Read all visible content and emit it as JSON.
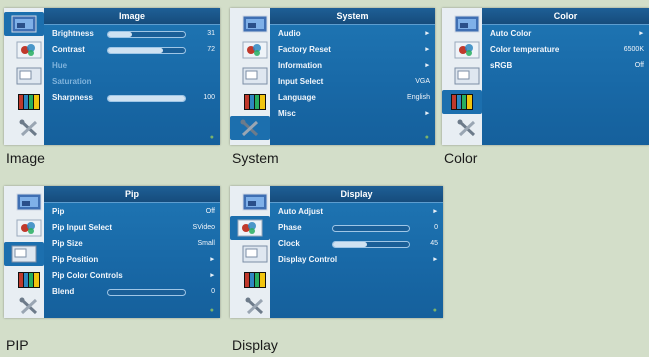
{
  "screens": [
    {
      "title": "Image",
      "caption": "Image",
      "rows": [
        {
          "label": "Brightness",
          "value": "31",
          "level": 0.31
        },
        {
          "label": "Contrast",
          "value": "72",
          "level": 0.72
        },
        {
          "label": "Hue",
          "disabled": true
        },
        {
          "label": "Saturation",
          "disabled": true
        },
        {
          "label": "Sharpness",
          "value": "100",
          "level": 1.0
        }
      ]
    },
    {
      "title": "System",
      "caption": "System",
      "rows": [
        {
          "label": "Audio",
          "arrow": true
        },
        {
          "label": "Factory Reset",
          "arrow": true
        },
        {
          "label": "Information",
          "arrow": true
        },
        {
          "label": "Input Select",
          "value": "VGA"
        },
        {
          "label": "Language",
          "value": "English"
        },
        {
          "label": "Misc",
          "arrow": true
        }
      ]
    },
    {
      "title": "Color",
      "caption": "Color",
      "rows": [
        {
          "label": "Auto Color",
          "arrow": true
        },
        {
          "label": "Color temperature",
          "value": "6500K"
        },
        {
          "label": "sRGB",
          "value": "Off"
        }
      ]
    },
    {
      "title": "Pip",
      "caption": "PIP",
      "rows": [
        {
          "label": "Pip",
          "value": "Off"
        },
        {
          "label": "Pip Input Select",
          "value": "SVideo"
        },
        {
          "label": "Pip Size",
          "value": "Small"
        },
        {
          "label": "Pip Position",
          "arrow": true
        },
        {
          "label": "Pip Color Controls",
          "arrow": true
        },
        {
          "label": "Blend",
          "value": "0",
          "level": 0.0
        }
      ]
    },
    {
      "title": "Display",
      "caption": "Display",
      "rows": [
        {
          "label": "Auto Adjust",
          "arrow": true
        },
        {
          "label": "Phase",
          "value": "0",
          "level": 0.0
        },
        {
          "label": "Clock",
          "value": "45",
          "level": 0.45
        },
        {
          "label": "Display Control",
          "arrow": true
        }
      ]
    }
  ],
  "sidebar_icons": [
    "image-icon",
    "color-icon",
    "pip-icon",
    "display-icon",
    "system-icon"
  ],
  "colors": {
    "panel": "#1868a6",
    "sidebar": "#e8eef3",
    "selected": "#1c6fae",
    "background": "#d3dec9"
  }
}
